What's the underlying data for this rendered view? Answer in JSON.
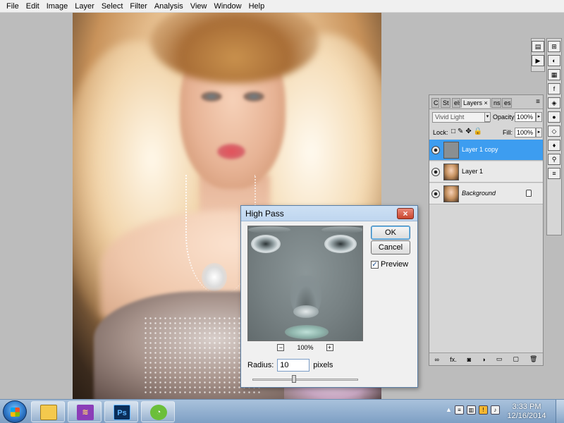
{
  "menubar": {
    "items": [
      "File",
      "Edit",
      "Image",
      "Layer",
      "Select",
      "Filter",
      "Analysis",
      "View",
      "Window",
      "Help"
    ]
  },
  "high_pass": {
    "title": "High Pass",
    "close_icon": "×",
    "ok_label": "OK",
    "cancel_label": "Cancel",
    "preview_label": "Preview",
    "preview_checked": true,
    "zoom_minus": "−",
    "zoom_plus": "+",
    "zoom_level": "100%",
    "radius_label": "Radius:",
    "radius_value": "10",
    "radius_unit": "pixels"
  },
  "layers_panel": {
    "tabs": [
      "C",
      "St",
      "els",
      "Layers",
      "ns",
      "es"
    ],
    "active_tab": "Layers",
    "blend_mode": "Vivid Light",
    "opacity_label": "Opacity:",
    "opacity_value": "100%",
    "lock_label": "Lock:",
    "fill_label": "Fill:",
    "fill_value": "100%",
    "layers": [
      {
        "name": "Layer 1 copy",
        "selected": true
      },
      {
        "name": "Layer 1",
        "selected": false
      },
      {
        "name": "Background",
        "selected": false,
        "locked": true
      }
    ],
    "footer_icons": [
      "link-icon",
      "fx-icon",
      "mask-icon",
      "adjustment-icon",
      "folder-icon",
      "new-layer-icon",
      "trash-icon"
    ],
    "footer_fx": "fx."
  },
  "taskbar": {
    "apps": [
      {
        "name": "explorer",
        "color": "#f4c94d"
      },
      {
        "name": "library",
        "color": "#8b3db8"
      },
      {
        "name": "photoshop",
        "label": "Ps",
        "color": "#0b2e59"
      },
      {
        "name": "green-app",
        "color": "#6bbf3a"
      }
    ],
    "time": "3:33 PM",
    "date": "12/16/2014"
  },
  "colors": {
    "accent": "#3d9df0",
    "photoshop_icon_text": "#5fb5ff"
  }
}
